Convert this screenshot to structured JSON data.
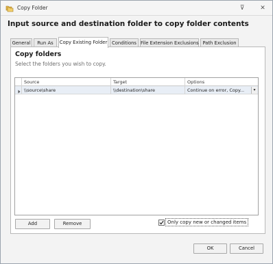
{
  "window": {
    "title": "Copy Folder",
    "pin_glyph": "⊽",
    "close_glyph": "✕"
  },
  "header": {
    "text": "Input source and destination folder to copy folder contents"
  },
  "tabs": [
    {
      "label": "General",
      "active": false
    },
    {
      "label": "Run As",
      "active": false
    },
    {
      "label": "Copy Existing Folder",
      "active": true
    },
    {
      "label": "Conditions",
      "active": false
    },
    {
      "label": "File Extension Exclusions",
      "active": false
    },
    {
      "label": "Path Exclusion",
      "active": false
    }
  ],
  "panel": {
    "title": "Copy folders",
    "subtitle": "Select the folders you wish to copy."
  },
  "grid": {
    "columns": [
      "Source",
      "Target",
      "Options"
    ],
    "rows": [
      {
        "source": "\\\\source\\share",
        "target": "\\\\destination\\share",
        "options": "Continue on error, Copy..."
      }
    ]
  },
  "buttons": {
    "add": "Add",
    "remove": "Remove",
    "ok": "OK",
    "cancel": "Cancel"
  },
  "checkbox": {
    "label": "Only copy new or changed items",
    "checked": true
  },
  "icons": {
    "app": "folder-copy-icon",
    "row_indicator": "triangle-right-icon",
    "dropdown": "chevron-down-icon"
  }
}
